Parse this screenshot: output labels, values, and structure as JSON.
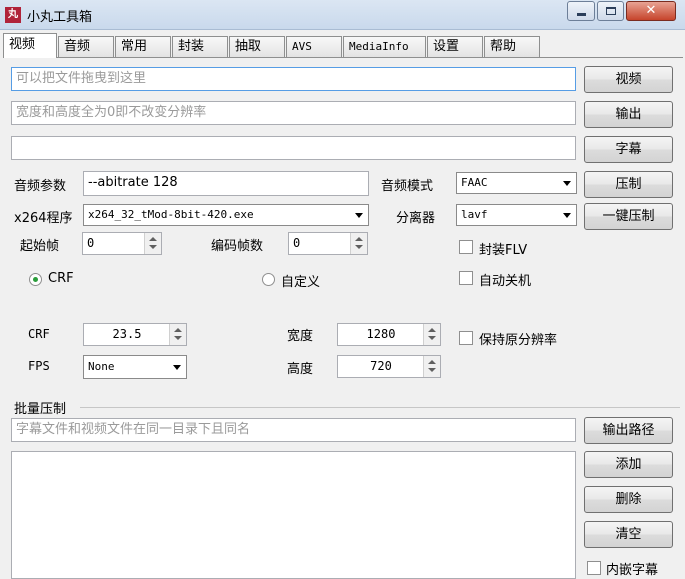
{
  "window": {
    "title": "小丸工具箱",
    "icon_text": "丸"
  },
  "tabs": [
    {
      "label": "视频",
      "active": true
    },
    {
      "label": "音频"
    },
    {
      "label": "常用"
    },
    {
      "label": "封装"
    },
    {
      "label": "抽取"
    },
    {
      "label": "AVS"
    },
    {
      "label": "MediaInfo"
    },
    {
      "label": "设置"
    },
    {
      "label": "帮助"
    }
  ],
  "video": {
    "input_placeholder": "可以把文件拖曳到这里",
    "output_placeholder": "宽度和高度全为0即不改变分辨率",
    "subtitle_value": "",
    "btn_video": "视频",
    "btn_output": "输出",
    "btn_subtitle": "字幕",
    "btn_compress": "压制",
    "btn_onekey": "一键压制",
    "audio_param_label": "音频参数",
    "audio_param_value": "--abitrate 128",
    "audio_mode_label": "音频模式",
    "audio_mode_value": "FAAC",
    "x264_label": "x264程序",
    "x264_value": "x264_32_tMod-8bit-420.exe",
    "demuxer_label": "分离器",
    "demuxer_value": "lavf",
    "start_frame_label": "起始帧",
    "start_frame_value": "0",
    "encode_frames_label": "编码帧数",
    "encode_frames_value": "0",
    "flv_label": "封装FLV",
    "autoshutdown_label": "自动关机",
    "crf_radio_label": "CRF",
    "custom_radio_label": "自定义",
    "crf_label": "CRF",
    "crf_value": "23.5",
    "fps_label": "FPS",
    "fps_value": "None",
    "width_label": "宽度",
    "width_value": "1280",
    "height_label": "高度",
    "height_value": "720",
    "keep_res_label": "保持原分辨率"
  },
  "batch": {
    "group_label": "批量压制",
    "path_placeholder": "字幕文件和视频文件在同一目录下且同名",
    "btn_output_path": "输出路径",
    "btn_add": "添加",
    "btn_delete": "删除",
    "btn_clear": "清空",
    "embed_sub_label": "内嵌字幕"
  }
}
